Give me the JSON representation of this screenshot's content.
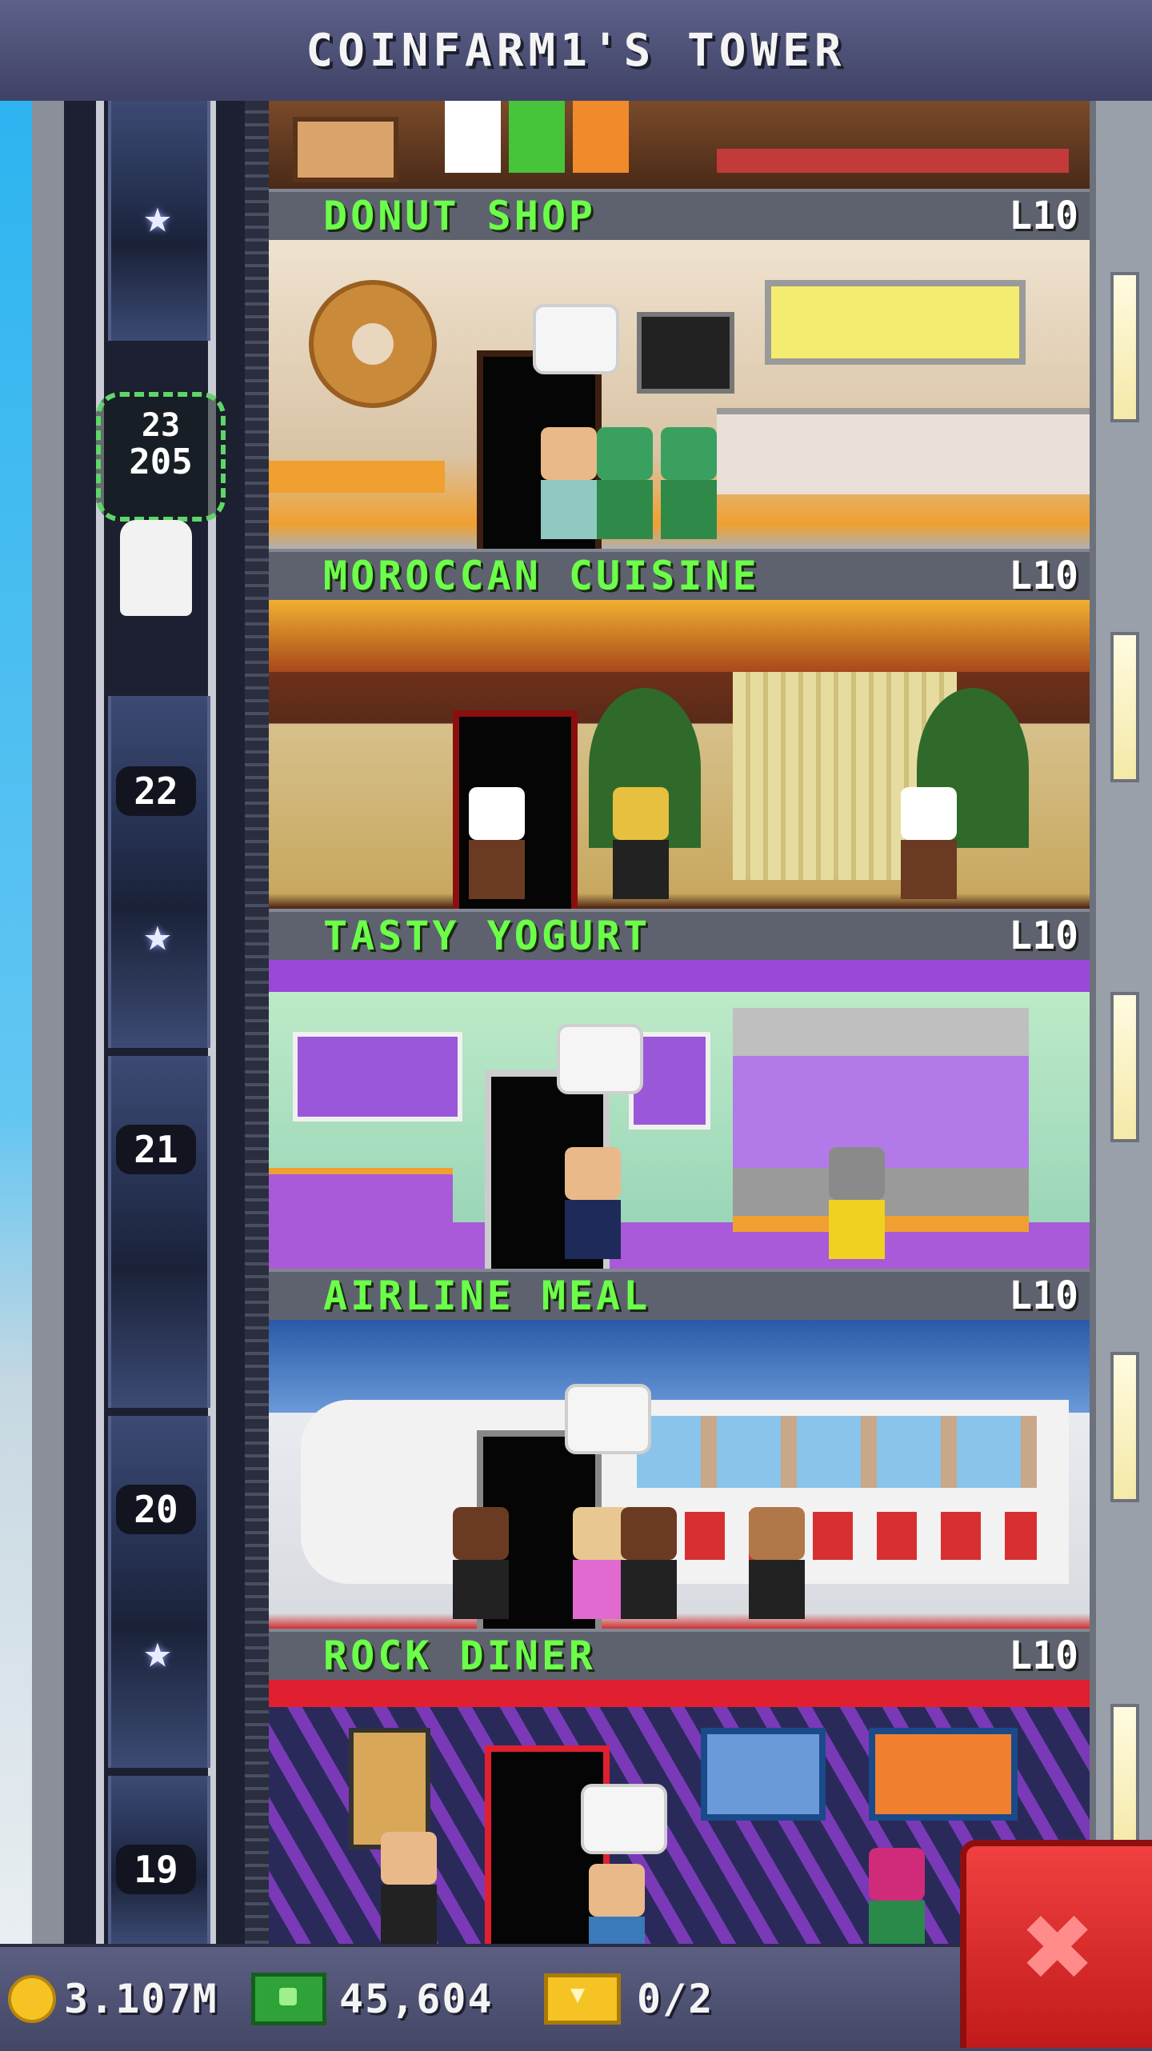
{
  "header": {
    "title": "COINFARM1'S TOWER"
  },
  "elevator": {
    "floor_numbers": [
      "22",
      "21",
      "20",
      "19"
    ],
    "current": {
      "floor": "23",
      "coins": "205"
    },
    "star_icon": "star-icon"
  },
  "floors": [
    {
      "name": "DONUT SHOP",
      "level": "L10"
    },
    {
      "name": "MOROCCAN CUISINE",
      "level": "L10"
    },
    {
      "name": "TASTY YOGURT",
      "level": "L10"
    },
    {
      "name": "AIRLINE MEAL",
      "level": "L10"
    },
    {
      "name": "ROCK DINER",
      "level": "L10"
    }
  ],
  "status": {
    "coins": "3.107M",
    "bux": "45,604",
    "tickets": "0/2"
  },
  "close_label": "✖",
  "colors": {
    "floor_name": "#6cff4a",
    "accent_close": "#e23030",
    "coin": "#f6c325",
    "bux": "#2fa33a"
  }
}
